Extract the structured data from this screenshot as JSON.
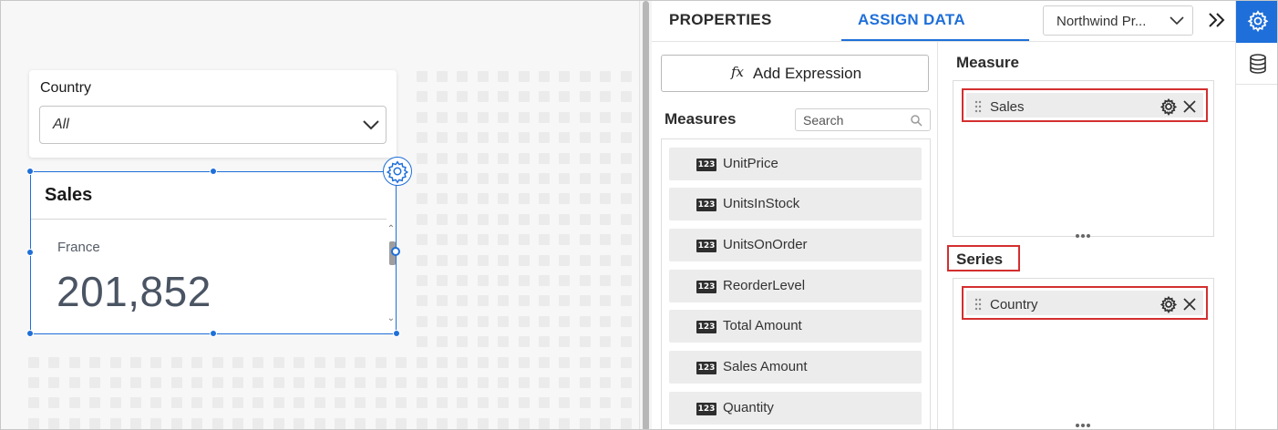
{
  "canvas": {
    "filter": {
      "title": "Country",
      "selected": "All"
    },
    "widget": {
      "title": "Sales",
      "label": "France",
      "value": "201,852"
    }
  },
  "panel": {
    "tabs": [
      {
        "label": "PROPERTIES",
        "active": false
      },
      {
        "label": "ASSIGN DATA",
        "active": true
      }
    ],
    "datasource": "Northwind Pr...",
    "add_expression": "Add Expression",
    "add_expression_icon": "fx",
    "measures": {
      "title": "Measures",
      "search_placeholder": "Search",
      "badge": "123",
      "items": [
        "UnitPrice",
        "UnitsInStock",
        "UnitsOnOrder",
        "ReorderLevel",
        "Total Amount",
        "Sales Amount",
        "Quantity"
      ]
    },
    "measure_section": {
      "title": "Measure",
      "field": "Sales"
    },
    "series_section": {
      "title": "Series",
      "field": "Country"
    }
  },
  "colors": {
    "accent": "#1e6fd9",
    "highlight": "#d32f2f"
  },
  "icons": [
    "chevron-down-icon",
    "gear-icon",
    "chevrons-right-icon",
    "database-icon",
    "search-icon",
    "drag-handle-icon",
    "close-icon",
    "more-dots-icon"
  ]
}
